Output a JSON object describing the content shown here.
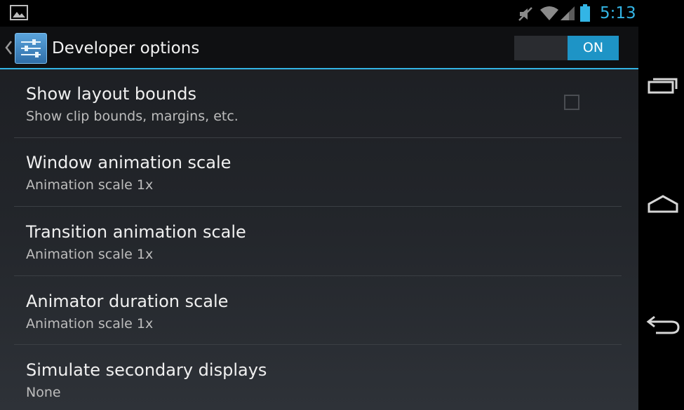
{
  "status_bar": {
    "time": "5:13",
    "icons": [
      "gallery-icon",
      "mute-icon",
      "wifi-icon",
      "signal-icon",
      "battery-icon"
    ]
  },
  "action_bar": {
    "title": "Developer options",
    "toggle_label": "ON",
    "toggle_state": "on"
  },
  "settings": [
    {
      "title": "Show layout bounds",
      "summary": "Show clip bounds, margins, etc.",
      "checked": false
    },
    {
      "title": "Window animation scale",
      "summary": "Animation scale 1x"
    },
    {
      "title": "Transition animation scale",
      "summary": "Animation scale 1x"
    },
    {
      "title": "Animator duration scale",
      "summary": "Animation scale 1x"
    },
    {
      "title": "Simulate secondary displays",
      "summary": "None"
    }
  ],
  "nav_bar": [
    "recent-apps-icon",
    "home-icon",
    "back-icon"
  ],
  "colors": {
    "accent": "#33b5e5",
    "toggle_on": "#1e94c6",
    "background": "#1b1d21",
    "text_primary": "#f0f0f0",
    "text_secondary": "#bdbdbd"
  }
}
